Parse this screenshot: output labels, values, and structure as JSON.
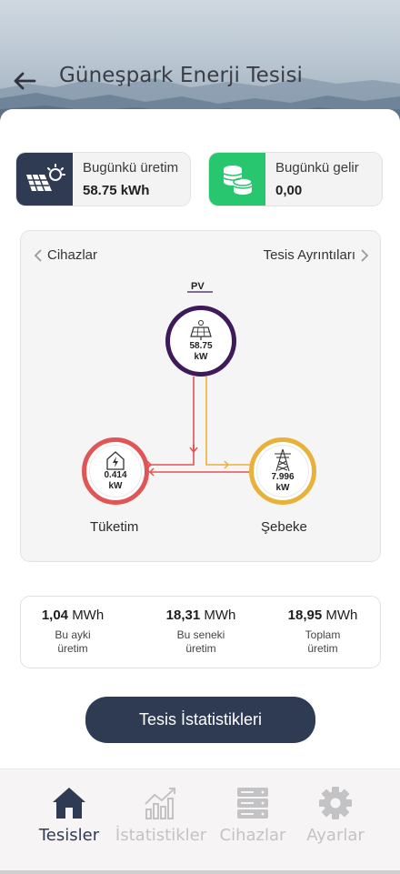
{
  "header": {
    "title": "Güneşpark Enerji Tesisi",
    "back_icon": "arrow-left-icon"
  },
  "summary": {
    "production": {
      "label": "Bugünkü üretim",
      "value": "58.75 kWh",
      "icon": "solar-panel-icon",
      "color": "#2f3b52"
    },
    "income": {
      "label": "Bugünkü gelir",
      "value": "0,00",
      "icon": "coins-icon",
      "color": "#28c76f"
    }
  },
  "flow": {
    "left_link": "Cihazlar",
    "right_link": "Tesis Ayrıntıları",
    "pv": {
      "label": "PV",
      "value": "58.75",
      "unit": "kW",
      "color": "#3f1a5a"
    },
    "consumption": {
      "label": "Tüketim",
      "value": "0.414",
      "unit": "kW",
      "color": "#e05555"
    },
    "grid": {
      "label": "Şebeke",
      "value": "7.996",
      "unit": "kW",
      "color": "#e8b23a"
    }
  },
  "stats": [
    {
      "value": "1,04",
      "unit": "MWh",
      "caption_1": "Bu ayki",
      "caption_2": "üretim"
    },
    {
      "value": "18,31",
      "unit": "MWh",
      "caption_1": "Bu seneki",
      "caption_2": "üretim"
    },
    {
      "value": "18,95",
      "unit": "MWh",
      "caption_1": "Toplam",
      "caption_2": "üretim"
    }
  ],
  "cta_label": "Tesis İstatistikleri",
  "tabs": [
    {
      "label": "Tesisler",
      "icon": "home-icon",
      "active": true
    },
    {
      "label": "İstatistikler",
      "icon": "chart-icon",
      "active": false
    },
    {
      "label": "Cihazlar",
      "icon": "server-icon",
      "active": false
    },
    {
      "label": "Ayarlar",
      "icon": "gear-icon",
      "active": false
    }
  ]
}
